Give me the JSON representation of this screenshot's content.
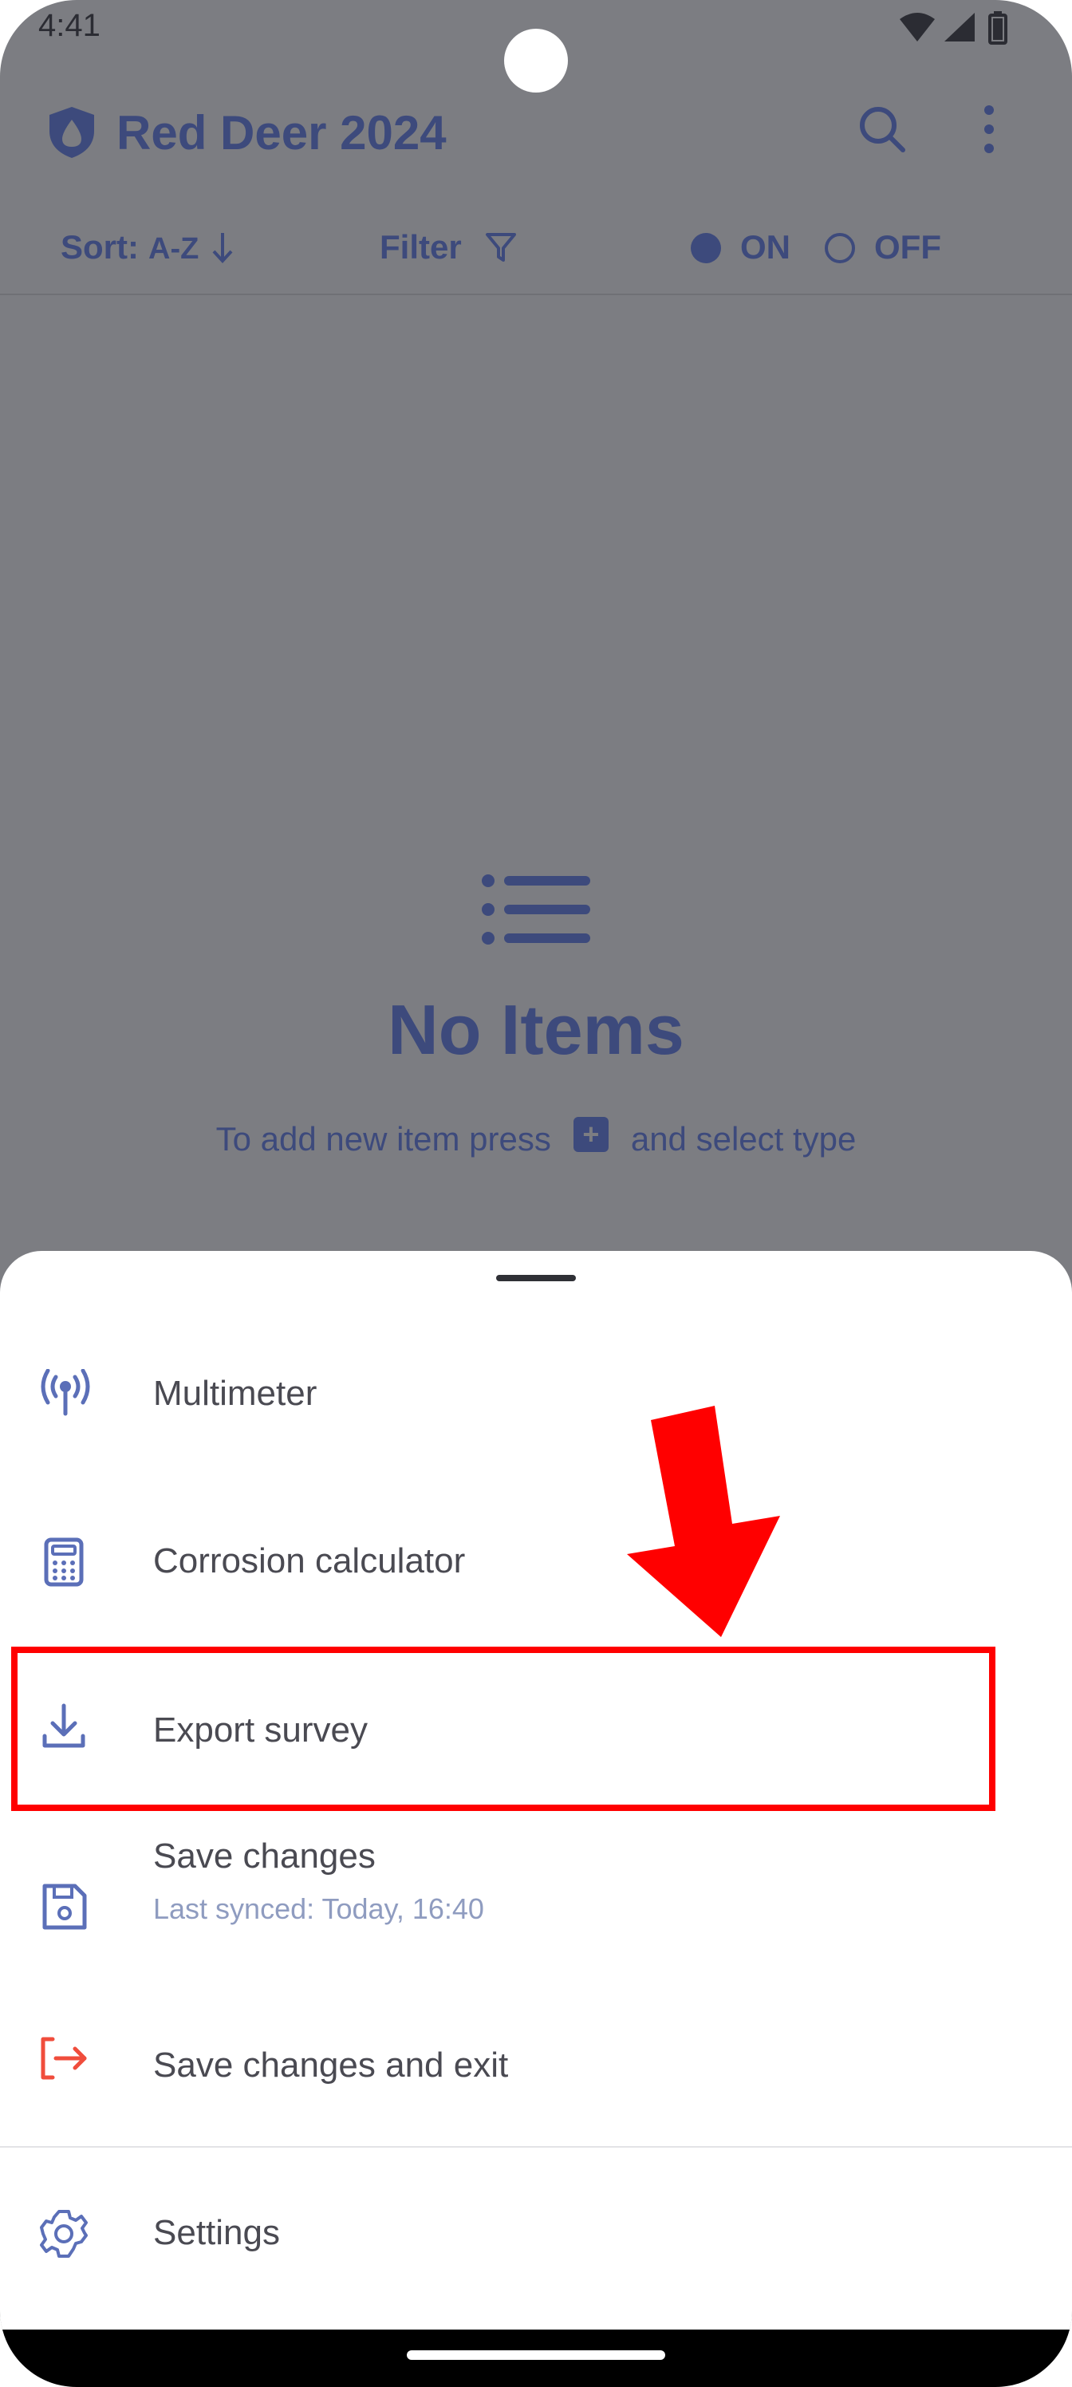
{
  "status_bar": {
    "time": "4:41"
  },
  "app_bar": {
    "title": "Red Deer 2024",
    "logo_icon": "shield-drop-icon",
    "actions": [
      "search-icon",
      "more-vert-icon"
    ]
  },
  "toolbar": {
    "sort_label": "Sort:",
    "sort_value": "A-Z",
    "sort_icon": "arrow-down-icon",
    "filter_label": "Filter",
    "filter_icon": "filter-icon",
    "on_label": "ON",
    "off_label": "OFF",
    "selected": "ON"
  },
  "empty_state": {
    "icon": "list-icon",
    "title": "No Items",
    "hint_before": "To add new item press",
    "hint_after": "and select type",
    "hint_button": "+"
  },
  "sheet": {
    "items": [
      {
        "label": "Multimeter",
        "icon": "antenna-icon"
      },
      {
        "label": "Corrosion calculator",
        "icon": "calculator-icon"
      },
      {
        "label": "Export survey",
        "icon": "download-icon",
        "highlighted": true
      },
      {
        "label": "Save changes",
        "sub": "Last synced: Today, 16:40",
        "icon": "save-icon"
      },
      {
        "label": "Save changes and exit",
        "icon": "exit-icon"
      },
      {
        "label": "Settings",
        "icon": "gear-icon"
      }
    ]
  },
  "colors": {
    "primary": "#3d4a7c",
    "icon": "#5b6fb8",
    "exit": "#f04d3c",
    "scrim": "#7c7d82",
    "highlight": "#ff0000"
  }
}
